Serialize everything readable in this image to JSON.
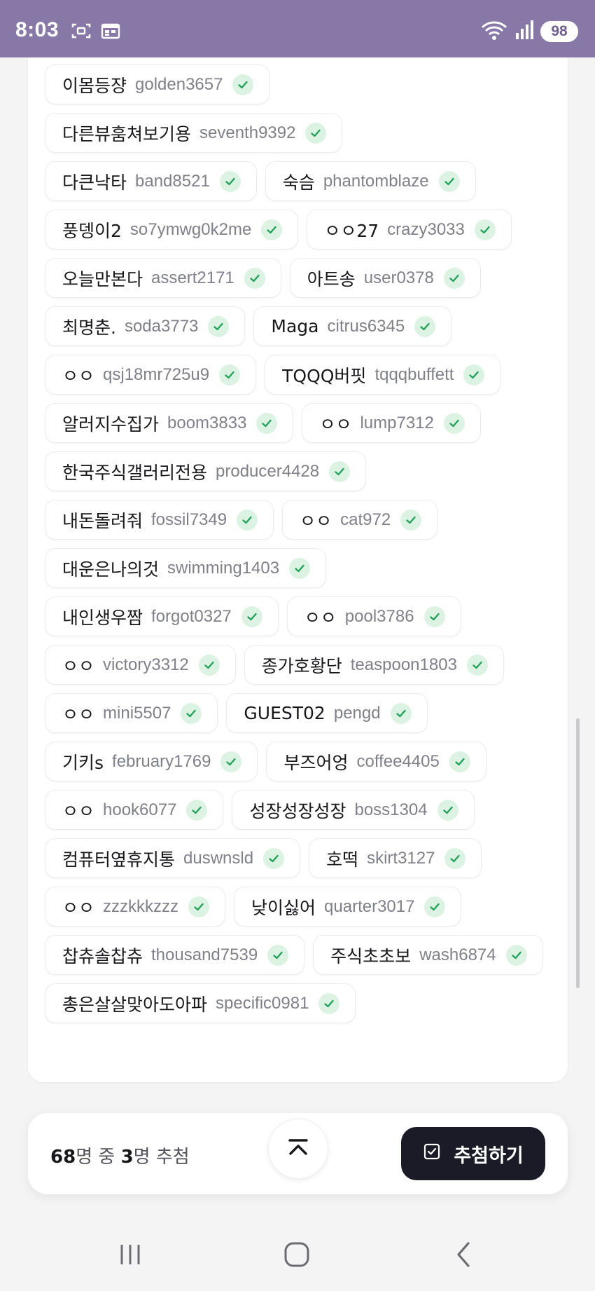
{
  "status_bar": {
    "time": "8:03",
    "battery": "98",
    "icons_left": [
      "screenshot-icon",
      "calendar-icon"
    ],
    "icons_right": [
      "wifi-icon",
      "signal-icon"
    ]
  },
  "participants": [
    {
      "nickname": "이몸등쟝",
      "id": "golden3657"
    },
    {
      "nickname": "다른뷰훔쳐보기용",
      "id": "seventh9392"
    },
    {
      "nickname": "다큰낙타",
      "id": "band8521"
    },
    {
      "nickname": "숙슴",
      "id": "phantomblaze"
    },
    {
      "nickname": "풍뎅이2",
      "id": "so7ymwg0k2me"
    },
    {
      "nickname": "ㅇㅇ27",
      "id": "crazy3033"
    },
    {
      "nickname": "오늘만본다",
      "id": "assert2171"
    },
    {
      "nickname": "아트송",
      "id": "user0378"
    },
    {
      "nickname": "최명춘.",
      "id": "soda3773"
    },
    {
      "nickname": "Maga",
      "id": "citrus6345"
    },
    {
      "nickname": "ㅇㅇ",
      "id": "qsj18mr725u9"
    },
    {
      "nickname": "TQQQ버핏",
      "id": "tqqqbuffett"
    },
    {
      "nickname": "알러지수집가",
      "id": "boom3833"
    },
    {
      "nickname": "ㅇㅇ",
      "id": "lump7312"
    },
    {
      "nickname": "한국주식갤러리전용",
      "id": "producer4428"
    },
    {
      "nickname": "내돈돌려줘",
      "id": "fossil7349"
    },
    {
      "nickname": "ㅇㅇ",
      "id": "cat972"
    },
    {
      "nickname": "대운은나의것",
      "id": "swimming1403"
    },
    {
      "nickname": "내인생우짬",
      "id": "forgot0327"
    },
    {
      "nickname": "ㅇㅇ",
      "id": "pool3786"
    },
    {
      "nickname": "ㅇㅇ",
      "id": "victory3312"
    },
    {
      "nickname": "종가호황단",
      "id": "teaspoon1803"
    },
    {
      "nickname": "ㅇㅇ",
      "id": "mini5507"
    },
    {
      "nickname": "GUEST02",
      "id": "pengd"
    },
    {
      "nickname": "기키s",
      "id": "february1769"
    },
    {
      "nickname": "부즈어엉",
      "id": "coffee4405"
    },
    {
      "nickname": "ㅇㅇ",
      "id": "hook6077"
    },
    {
      "nickname": "성장성장성장",
      "id": "boss1304"
    },
    {
      "nickname": "컴퓨터옆휴지통",
      "id": "duswnsld"
    },
    {
      "nickname": "호떡",
      "id": "skirt3127"
    },
    {
      "nickname": "ㅇㅇ",
      "id": "zzzkkkzzz"
    },
    {
      "nickname": "낮이싫어",
      "id": "quarter3017"
    },
    {
      "nickname": "찹츄솔찹츄",
      "id": "thousand7539"
    },
    {
      "nickname": "주식초초보",
      "id": "wash6874"
    },
    {
      "nickname": "총은살살맞아도아파",
      "id": "specific0981"
    }
  ],
  "summary": {
    "total": "68",
    "total_suffix": "명 중 ",
    "winners": "3",
    "winners_suffix": "명 추첨"
  },
  "actions": {
    "draw_label": "추첨하기"
  },
  "colors": {
    "status_bar": "#8878a8",
    "check_green": "#22a35a",
    "check_bg": "#dcf3e4",
    "draw_button": "#1a1b26"
  }
}
